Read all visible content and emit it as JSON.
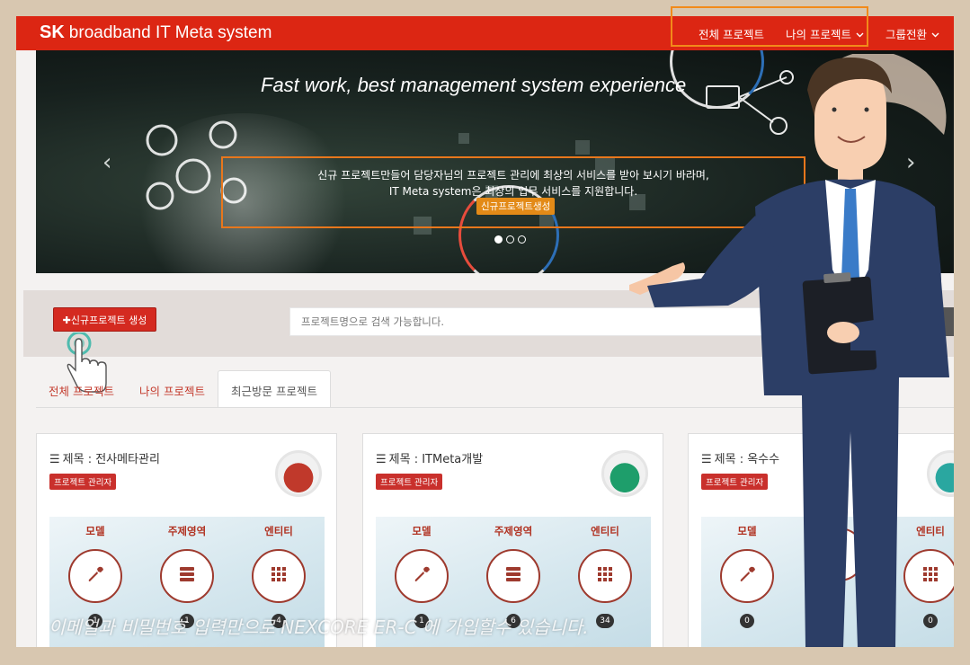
{
  "header": {
    "logo_sk": "SK",
    "logo_rest": "broadband IT Meta system",
    "nav": [
      {
        "label": "전체 프로젝트",
        "has_caret": false
      },
      {
        "label": "나의 프로젝트",
        "has_caret": true
      },
      {
        "label": "그룹전환",
        "has_caret": true
      }
    ]
  },
  "hero": {
    "title": "Fast work, best management system experience",
    "line1": "신규 프로젝트만들어 담당자님의 프로젝트 관리에 최상의 서비스를 받아 보시기 바라며,",
    "line2": "IT Meta system은 최상의 업무 서비스를 지원합니다.",
    "cta": "신규프로젝트생성",
    "slides": 3,
    "active_slide": 0
  },
  "toolbar": {
    "new_project_label": "✚신규프로젝트 생성",
    "search_placeholder": "프로젝트명으로 검색 가능합니다."
  },
  "tabs": [
    {
      "label": "전체 프로젝트",
      "active": false
    },
    {
      "label": "나의 프로젝트",
      "active": false
    },
    {
      "label": "최근방문 프로젝트",
      "active": true
    }
  ],
  "cards": [
    {
      "title": "제목 : 전사메타관리",
      "role": "프로젝트 관리자",
      "thumb_color": "#c0392b",
      "stats": [
        {
          "label": "모델",
          "icon": "wrench-icon",
          "count": "1"
        },
        {
          "label": "주제영역",
          "icon": "server-icon",
          "count": "1"
        },
        {
          "label": "엔티티",
          "icon": "grid-icon",
          "count": "4"
        }
      ]
    },
    {
      "title": "제목 : ITMeta개발",
      "role": "프로젝트 관리자",
      "thumb_color": "#1e9e6b",
      "stats": [
        {
          "label": "모델",
          "icon": "wrench-icon",
          "count": "1"
        },
        {
          "label": "주제영역",
          "icon": "server-icon",
          "count": "6"
        },
        {
          "label": "엔티티",
          "icon": "grid-icon",
          "count": "34"
        }
      ]
    },
    {
      "title": "제목 : 옥수수",
      "role": "프로젝트 관리자",
      "thumb_color": "#2aa7a0",
      "stats": [
        {
          "label": "모델",
          "icon": "wrench-icon",
          "count": "0"
        },
        {
          "label": "",
          "icon": "server-icon",
          "count": ""
        },
        {
          "label": "엔티티",
          "icon": "grid-icon",
          "count": "0"
        }
      ]
    }
  ],
  "caption": "이메일과 비밀번호 입력만으로 NEXCORE ER-C 에 가입할수 있습니다.",
  "colors": {
    "brand_red": "#dc2613",
    "highlight_orange": "#f28a1a",
    "stat_red": "#b0301f"
  }
}
